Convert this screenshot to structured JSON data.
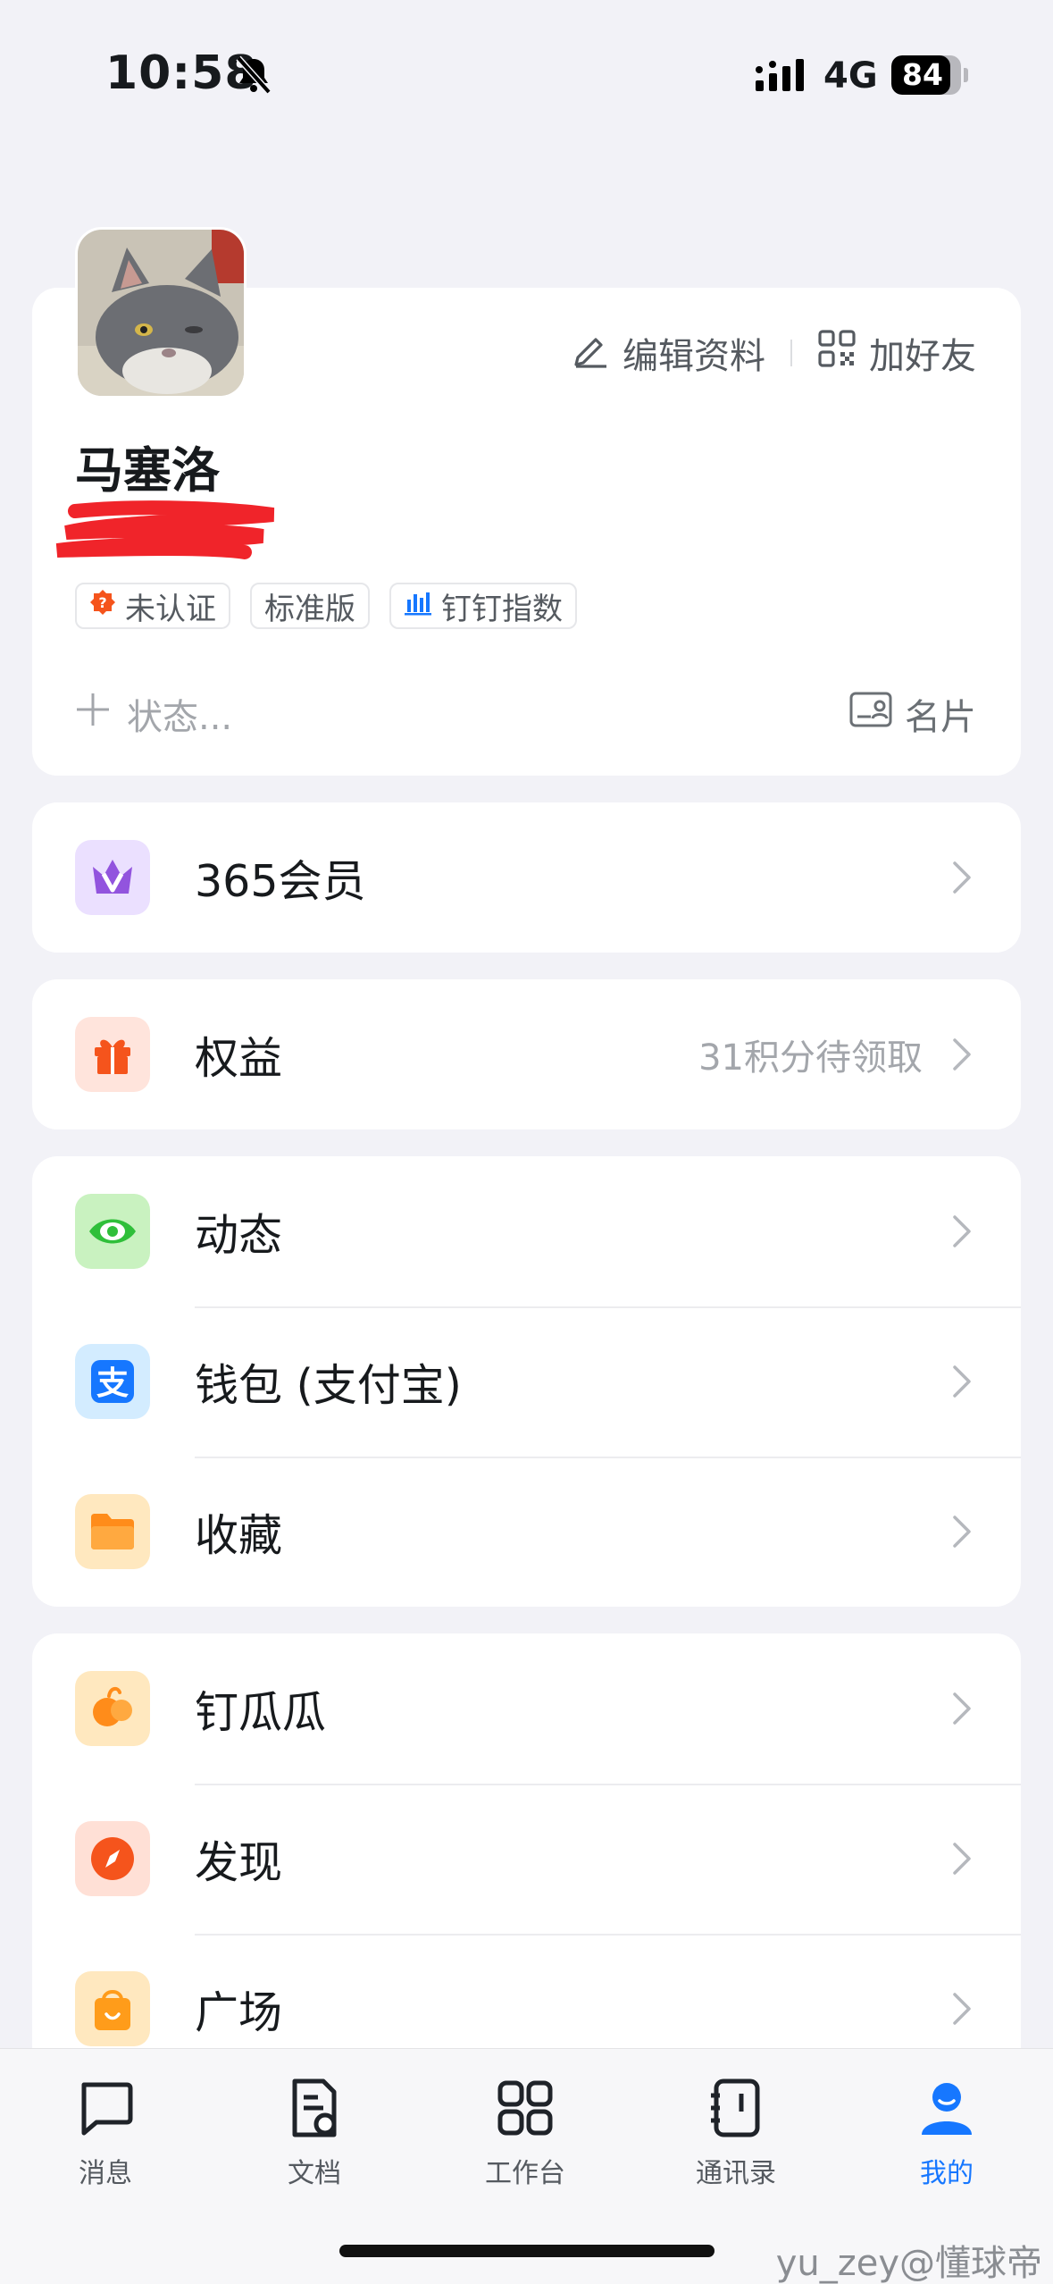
{
  "status_bar": {
    "time": "10:58",
    "network": "4G",
    "battery": "84",
    "battery_level": 0.84
  },
  "profile": {
    "name": "马塞洛",
    "edit_label": "编辑资料",
    "add_friend_label": "加好友",
    "tags": [
      "未认证",
      "标准版",
      "钉钉指数"
    ],
    "status_placeholder": "状态...",
    "business_card_label": "名片"
  },
  "menu": {
    "member": "365会员",
    "benefits": "权益",
    "benefits_extra": "31积分待领取",
    "moments": "动态",
    "wallet": "钱包 (支付宝)",
    "favorites": "收藏",
    "dinggua": "钉瓜瓜",
    "discover": "发现",
    "square": "广场"
  },
  "tabbar": {
    "messages": "消息",
    "docs": "文档",
    "workbench": "工作台",
    "contacts": "通讯录",
    "me": "我的"
  },
  "colors": {
    "accent": "#1677ff",
    "background": "#f2f2f7"
  },
  "watermark": "yu_zey@懂球帝"
}
